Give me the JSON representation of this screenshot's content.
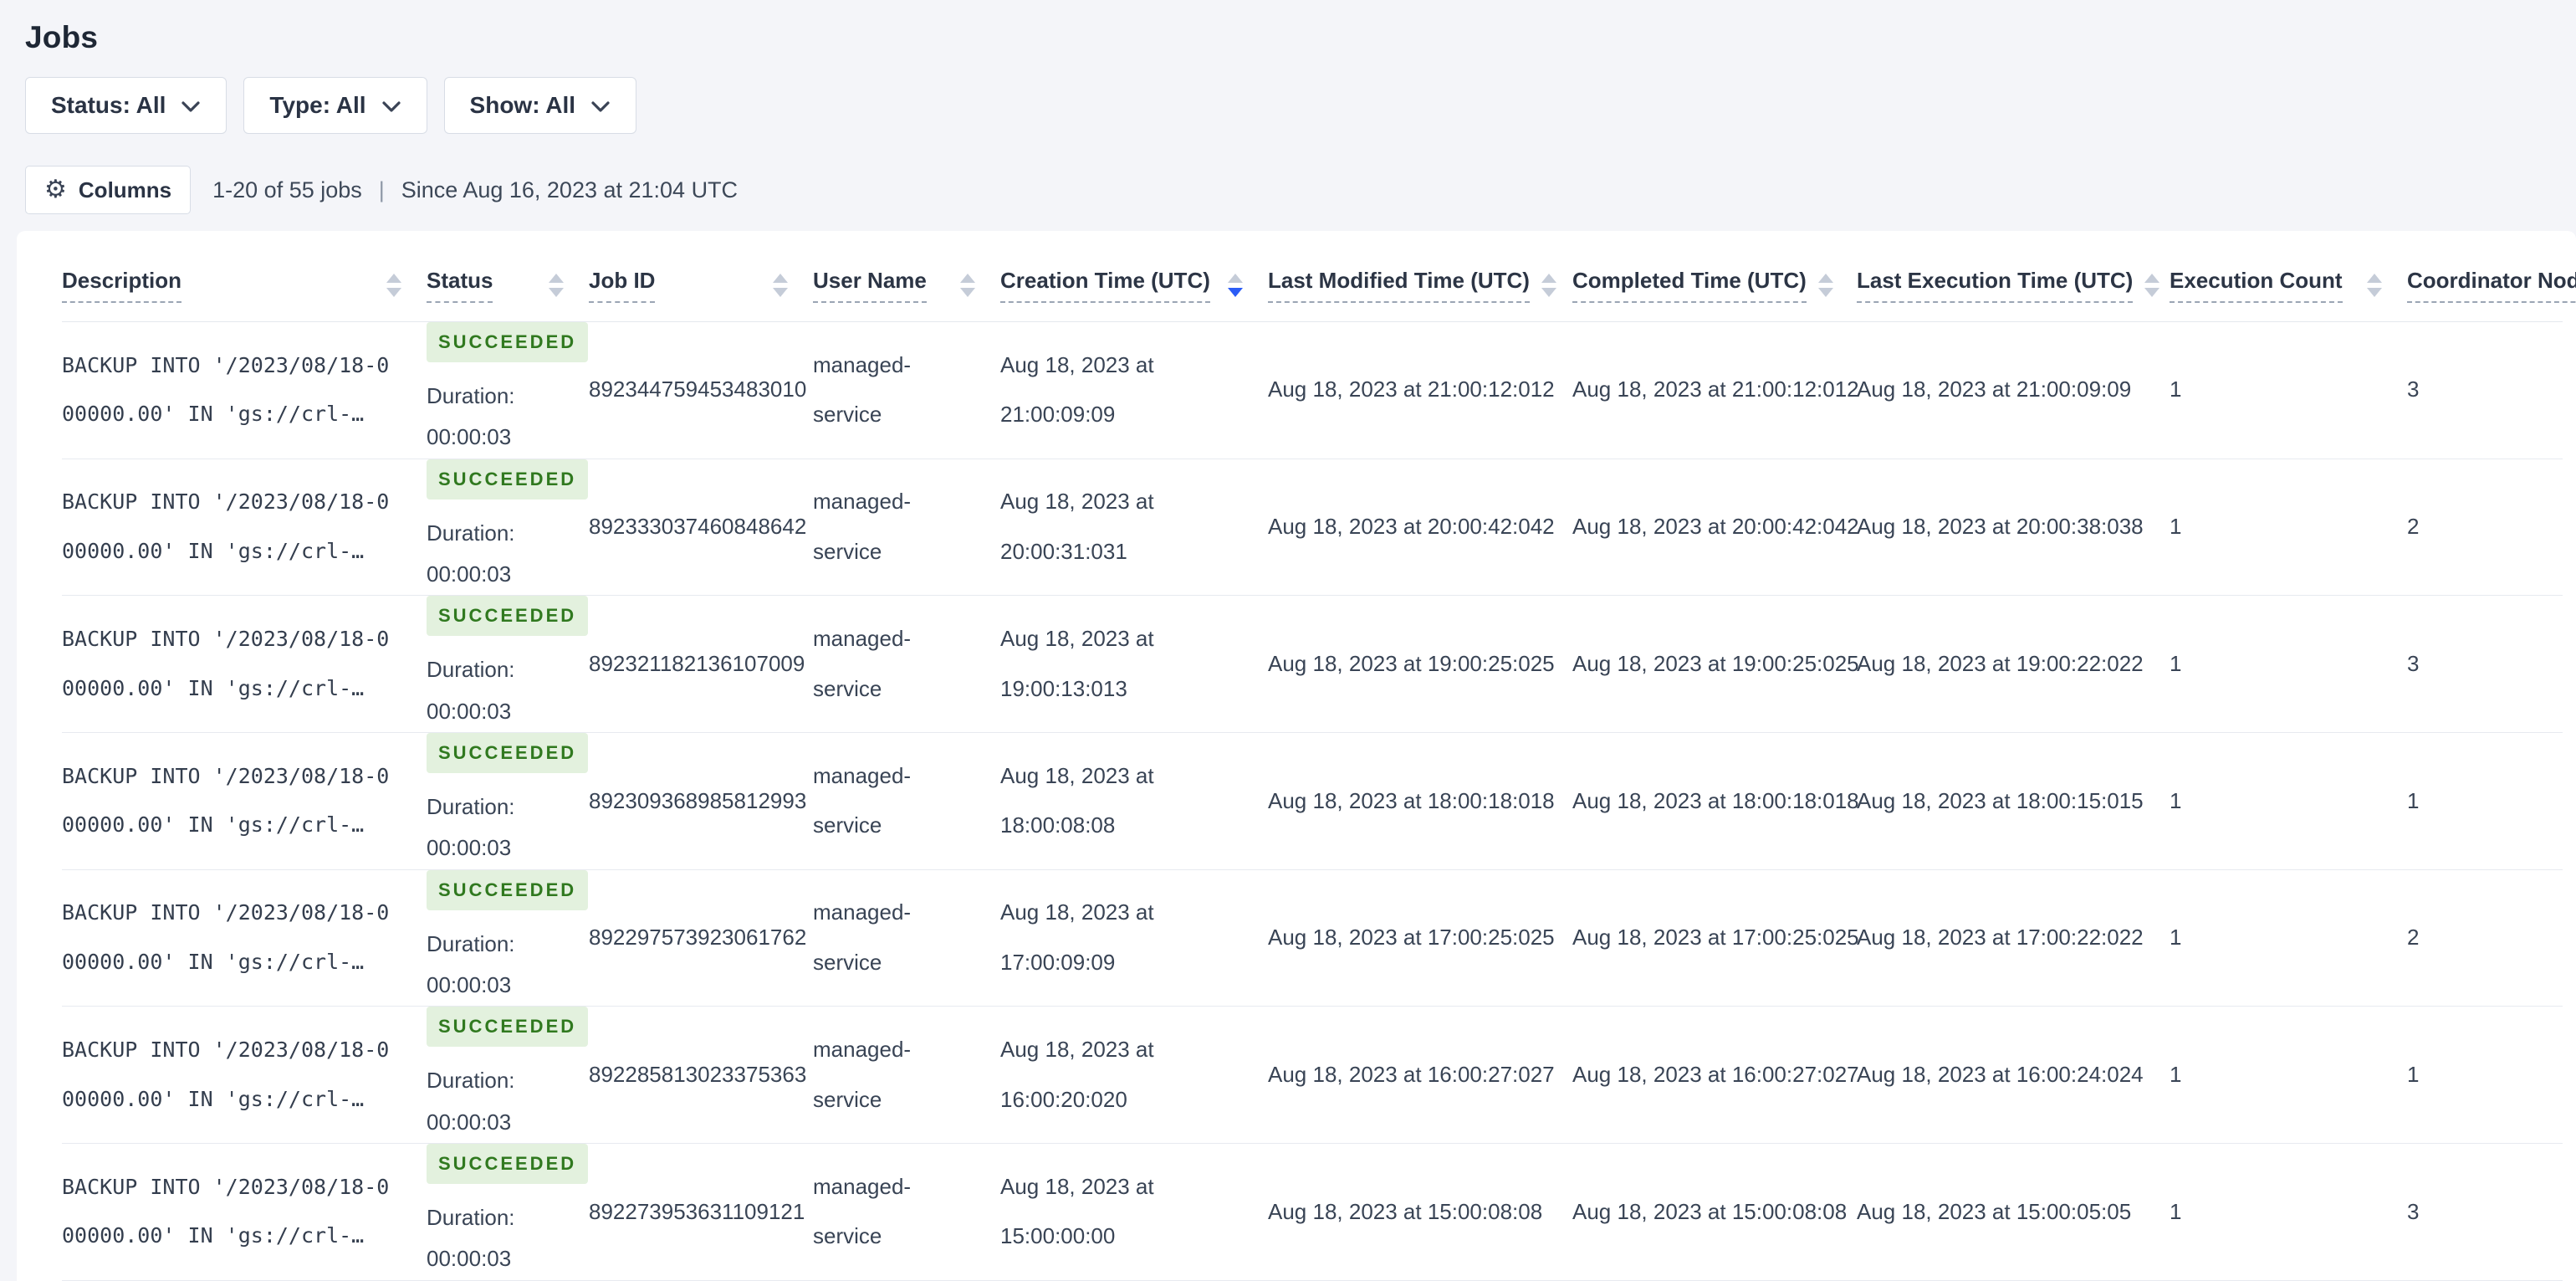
{
  "page": {
    "title": "Jobs"
  },
  "filters": [
    {
      "label": "Status: All"
    },
    {
      "label": "Type: All"
    },
    {
      "label": "Show: All"
    }
  ],
  "toolbar": {
    "columns_label": "Columns",
    "summary": "1-20 of 55 jobs",
    "separator": "|",
    "since": "Since Aug 16, 2023 at 21:04 UTC"
  },
  "icons": {
    "gear": "⚙"
  },
  "colors": {
    "accent_sort": "#2b5cf6",
    "badge_bg": "#e3f1de",
    "badge_text": "#30791f",
    "page_bg": "#f4f5f9"
  },
  "table": {
    "columns": [
      {
        "label": "Description",
        "sort": "none"
      },
      {
        "label": "Status",
        "sort": "none"
      },
      {
        "label": "Job ID",
        "sort": "none"
      },
      {
        "label": "User Name",
        "sort": "none"
      },
      {
        "label": "Creation Time (UTC)",
        "sort": "desc"
      },
      {
        "label": "Last Modified Time (UTC)",
        "sort": "none"
      },
      {
        "label": "Completed Time (UTC)",
        "sort": "none"
      },
      {
        "label": "Last Execution Time (UTC)",
        "sort": "none"
      },
      {
        "label": "Execution Count",
        "sort": "none"
      },
      {
        "label": "Coordinator Node",
        "sort": "none"
      }
    ],
    "rows": [
      {
        "description": "BACKUP INTO '/2023/08/18-000000.00' IN 'gs://crl-…",
        "status": "SUCCEEDED",
        "duration_label": "Duration:",
        "duration": "00:00:03",
        "job_id": "892344759453483010",
        "user_name": "managed-service",
        "creation_time": "Aug 18, 2023 at 21:00:09:09",
        "last_modified_time": "Aug 18, 2023 at 21:00:12:012",
        "completed_time": "Aug 18, 2023 at 21:00:12:012",
        "last_execution_time": "Aug 18, 2023 at 21:00:09:09",
        "execution_count": "1",
        "coordinator_node": "3"
      },
      {
        "description": "BACKUP INTO '/2023/08/18-000000.00' IN 'gs://crl-…",
        "status": "SUCCEEDED",
        "duration_label": "Duration:",
        "duration": "00:00:03",
        "job_id": "892333037460848642",
        "user_name": "managed-service",
        "creation_time": "Aug 18, 2023 at 20:00:31:031",
        "last_modified_time": "Aug 18, 2023 at 20:00:42:042",
        "completed_time": "Aug 18, 2023 at 20:00:42:042",
        "last_execution_time": "Aug 18, 2023 at 20:00:38:038",
        "execution_count": "1",
        "coordinator_node": "2"
      },
      {
        "description": "BACKUP INTO '/2023/08/18-000000.00' IN 'gs://crl-…",
        "status": "SUCCEEDED",
        "duration_label": "Duration:",
        "duration": "00:00:03",
        "job_id": "892321182136107009",
        "user_name": "managed-service",
        "creation_time": "Aug 18, 2023 at 19:00:13:013",
        "last_modified_time": "Aug 18, 2023 at 19:00:25:025",
        "completed_time": "Aug 18, 2023 at 19:00:25:025",
        "last_execution_time": "Aug 18, 2023 at 19:00:22:022",
        "execution_count": "1",
        "coordinator_node": "3"
      },
      {
        "description": "BACKUP INTO '/2023/08/18-000000.00' IN 'gs://crl-…",
        "status": "SUCCEEDED",
        "duration_label": "Duration:",
        "duration": "00:00:03",
        "job_id": "892309368985812993",
        "user_name": "managed-service",
        "creation_time": "Aug 18, 2023 at 18:00:08:08",
        "last_modified_time": "Aug 18, 2023 at 18:00:18:018",
        "completed_time": "Aug 18, 2023 at 18:00:18:018",
        "last_execution_time": "Aug 18, 2023 at 18:00:15:015",
        "execution_count": "1",
        "coordinator_node": "1"
      },
      {
        "description": "BACKUP INTO '/2023/08/18-000000.00' IN 'gs://crl-…",
        "status": "SUCCEEDED",
        "duration_label": "Duration:",
        "duration": "00:00:03",
        "job_id": "892297573923061762",
        "user_name": "managed-service",
        "creation_time": "Aug 18, 2023 at 17:00:09:09",
        "last_modified_time": "Aug 18, 2023 at 17:00:25:025",
        "completed_time": "Aug 18, 2023 at 17:00:25:025",
        "last_execution_time": "Aug 18, 2023 at 17:00:22:022",
        "execution_count": "1",
        "coordinator_node": "2"
      },
      {
        "description": "BACKUP INTO '/2023/08/18-000000.00' IN 'gs://crl-…",
        "status": "SUCCEEDED",
        "duration_label": "Duration:",
        "duration": "00:00:03",
        "job_id": "892285813023375363",
        "user_name": "managed-service",
        "creation_time": "Aug 18, 2023 at 16:00:20:020",
        "last_modified_time": "Aug 18, 2023 at 16:00:27:027",
        "completed_time": "Aug 18, 2023 at 16:00:27:027",
        "last_execution_time": "Aug 18, 2023 at 16:00:24:024",
        "execution_count": "1",
        "coordinator_node": "1"
      },
      {
        "description": "BACKUP INTO '/2023/08/18-000000.00' IN 'gs://crl-…",
        "status": "SUCCEEDED",
        "duration_label": "Duration:",
        "duration": "00:00:03",
        "job_id": "892273953631109121",
        "user_name": "managed-service",
        "creation_time": "Aug 18, 2023 at 15:00:00:00",
        "last_modified_time": "Aug 18, 2023 at 15:00:08:08",
        "completed_time": "Aug 18, 2023 at 15:00:08:08",
        "last_execution_time": "Aug 18, 2023 at 15:00:05:05",
        "execution_count": "1",
        "coordinator_node": "3"
      }
    ]
  }
}
